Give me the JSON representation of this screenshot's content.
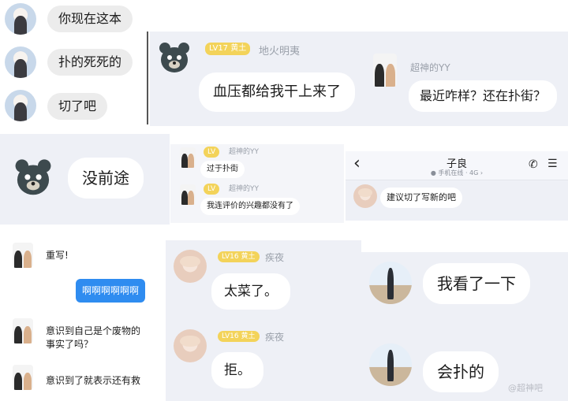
{
  "panel1": {
    "messages": [
      "你现在这本",
      "扑的死死的",
      "切了吧"
    ]
  },
  "panel2": {
    "badge": "LV17 黄土",
    "name": "地火明夷",
    "message": "血压都给我干上来了"
  },
  "panel3": {
    "name": "超神的YY",
    "message": "最近咋样？还在扑街？"
  },
  "panel4": {
    "message": "没前途"
  },
  "panel5": {
    "badge1": "LV",
    "name1": "超神的YY",
    "message1": "过于扑街",
    "badge2": "LV",
    "name2": "超神的YY",
    "message2": "我连评价的兴趣都没有了"
  },
  "panel6": {
    "back": "‹",
    "title": "子良",
    "status": "● 手机在线 · 4G ›",
    "call_icon": "✆",
    "menu_icon": "☰",
    "message": "建议切了写新的吧"
  },
  "panel7": {
    "messages": [
      "重写!",
      "啊啊啊啊啊啊",
      "意识到自己是个废物的事实了吗？",
      "意识到了就表示还有救"
    ],
    "line3a": "意识到自己是个废物的",
    "line3b": "事实了吗？"
  },
  "panel8": {
    "badge1": "LV16 黄土",
    "name1": "疾夜",
    "message1": "太菜了。",
    "badge2": "LV16 黄土",
    "name2": "疾夜",
    "message2": "拒。"
  },
  "panel9": {
    "message1": "我看了一下",
    "message2": "会扑的",
    "watermark": "@超神吧"
  }
}
